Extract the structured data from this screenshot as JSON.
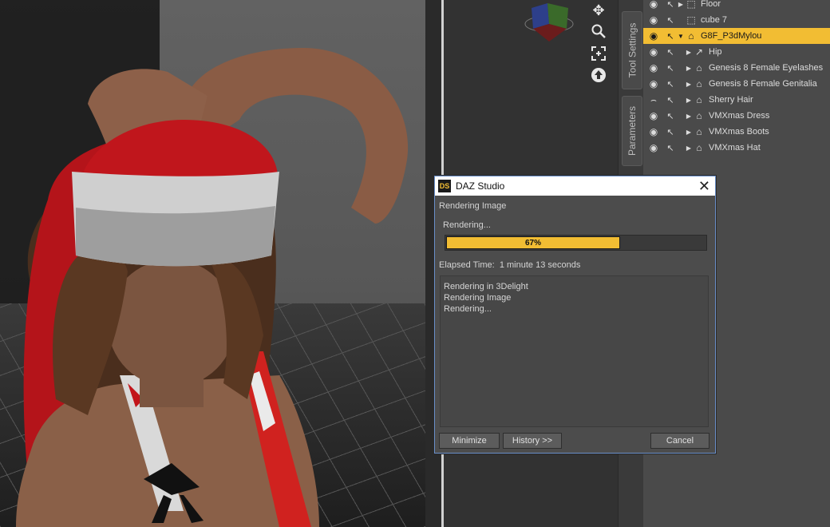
{
  "scene": {
    "items": [
      {
        "label": "Floor",
        "icon": "box-icon",
        "expand": "collapsed",
        "indent": 0
      },
      {
        "label": "cube 7",
        "icon": "box-icon",
        "expand": "none",
        "indent": 0
      },
      {
        "label": "G8F_P3dMylou",
        "icon": "figure-icon",
        "expand": "expanded",
        "indent": 0,
        "selected": true
      },
      {
        "label": "Hip",
        "icon": "bone-icon",
        "expand": "collapsed",
        "indent": 1
      },
      {
        "label": "Genesis 8 Female Eyelashes",
        "icon": "figure-icon",
        "expand": "collapsed",
        "indent": 1
      },
      {
        "label": "Genesis 8 Female Genitalia",
        "icon": "figure-icon",
        "expand": "collapsed",
        "indent": 1
      },
      {
        "label": "Sherry Hair",
        "icon": "figure-icon",
        "expand": "collapsed",
        "indent": 1,
        "hidden": true
      },
      {
        "label": "VMXmas Dress",
        "icon": "figure-icon",
        "expand": "collapsed",
        "indent": 1
      },
      {
        "label": "VMXmas Boots",
        "icon": "figure-icon",
        "expand": "collapsed",
        "indent": 1
      },
      {
        "label": "VMXmas Hat",
        "icon": "figure-icon",
        "expand": "collapsed",
        "indent": 1
      }
    ]
  },
  "side_tabs": {
    "tool_settings": "Tool Settings",
    "parameters": "Parameters"
  },
  "tools": [
    "move-icon",
    "zoom-icon",
    "frame-icon",
    "orbit-icon"
  ],
  "dialog": {
    "app_icon": "DS",
    "title": "DAZ Studio",
    "heading": "Rendering Image",
    "status": "Rendering...",
    "progress": 0.67,
    "progress_label": "67%",
    "elapsed_label": "Elapsed Time:",
    "elapsed_value": "1 minute 13 seconds",
    "log": [
      "Rendering in 3Delight",
      "Rendering Image",
      "Rendering..."
    ],
    "buttons": {
      "minimize": "Minimize",
      "history": "History >>",
      "cancel": "Cancel"
    }
  },
  "colors": {
    "accent": "#f2bd33",
    "dialog_bg": "#4c4c4c",
    "panel": "#4a4a4a"
  }
}
